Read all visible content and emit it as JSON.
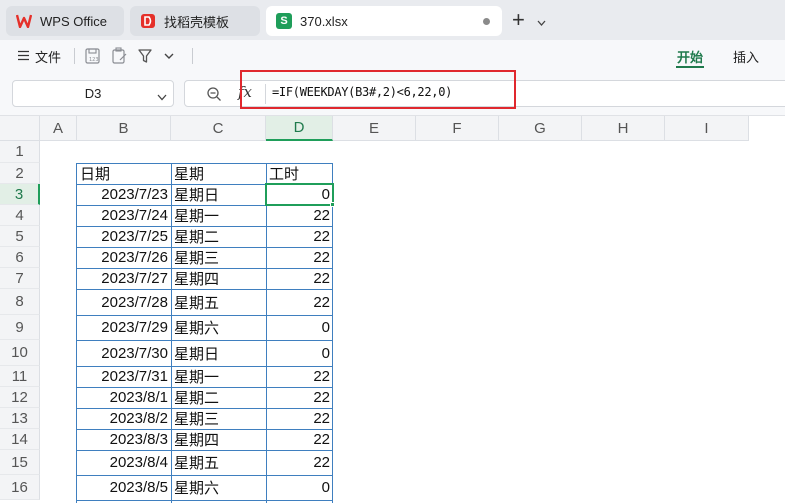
{
  "tabs": [
    {
      "label": "WPS Office",
      "icon": "wps-logo-icon"
    },
    {
      "label": "找稻壳模板",
      "icon": "docer-icon"
    },
    {
      "label": "370.xlsx",
      "icon": "spreadsheet-s-icon",
      "icon_letter": "S"
    }
  ],
  "menu": {
    "file_label": "文件",
    "ribbon_tabs": [
      "开始",
      "插入"
    ],
    "active_tab": "开始"
  },
  "formula_bar": {
    "cell_ref": "D3",
    "fx_label": "fx",
    "formula": "=IF(WEEKDAY(B3#,2)<6,22,0)"
  },
  "sheet": {
    "columns": [
      "A",
      "B",
      "C",
      "D",
      "E",
      "F",
      "G",
      "H",
      "I"
    ],
    "selected_column": "D",
    "rows": [
      "1",
      "2",
      "3",
      "4",
      "5",
      "6",
      "7",
      "8",
      "9",
      "10",
      "11",
      "12",
      "13",
      "14",
      "15",
      "16"
    ],
    "selected_row": "3",
    "headers": {
      "date": "日期",
      "weekday": "星期",
      "hours": "工时"
    },
    "data": [
      {
        "date": "2023/7/23",
        "weekday": "星期日",
        "hours": "0"
      },
      {
        "date": "2023/7/24",
        "weekday": "星期一",
        "hours": "22"
      },
      {
        "date": "2023/7/25",
        "weekday": "星期二",
        "hours": "22"
      },
      {
        "date": "2023/7/26",
        "weekday": "星期三",
        "hours": "22"
      },
      {
        "date": "2023/7/27",
        "weekday": "星期四",
        "hours": "22"
      },
      {
        "date": "2023/7/28",
        "weekday": "星期五",
        "hours": "22"
      },
      {
        "date": "2023/7/29",
        "weekday": "星期六",
        "hours": "0"
      },
      {
        "date": "2023/7/30",
        "weekday": "星期日",
        "hours": "0"
      },
      {
        "date": "2023/7/31",
        "weekday": "星期一",
        "hours": "22"
      },
      {
        "date": "2023/8/1",
        "weekday": "星期二",
        "hours": "22"
      },
      {
        "date": "2023/8/2",
        "weekday": "星期三",
        "hours": "22"
      },
      {
        "date": "2023/8/3",
        "weekday": "星期四",
        "hours": "22"
      },
      {
        "date": "2023/8/4",
        "weekday": "星期五",
        "hours": "22"
      },
      {
        "date": "2023/8/5",
        "weekday": "星期六",
        "hours": "0"
      }
    ]
  },
  "colors": {
    "accent": "#1f9e5a",
    "highlight_box": "#e0282e",
    "table_border": "#3f7fbf"
  }
}
